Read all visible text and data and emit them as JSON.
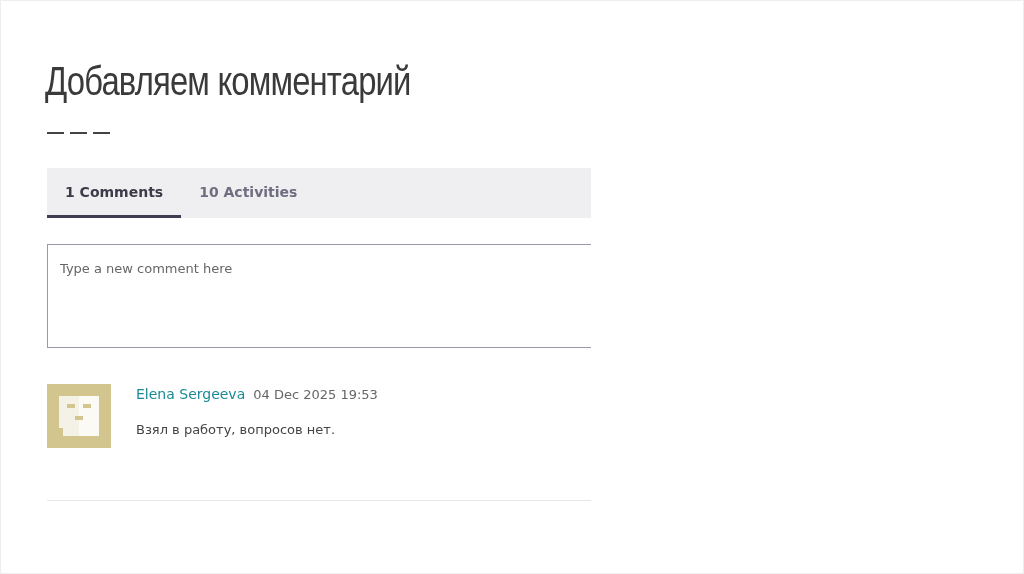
{
  "slide_title": "Добавляем комментарий",
  "tabs": [
    {
      "label": "1 Comments",
      "selected": true
    },
    {
      "label": "10 Activities",
      "selected": false
    }
  ],
  "comment_box": {
    "placeholder": "Type a new comment here"
  },
  "comments": [
    {
      "author": "Elena Sergeeva",
      "date": "04 Dec 2025 19:53",
      "text": "Взял в работу, вопросов нет."
    }
  ]
}
